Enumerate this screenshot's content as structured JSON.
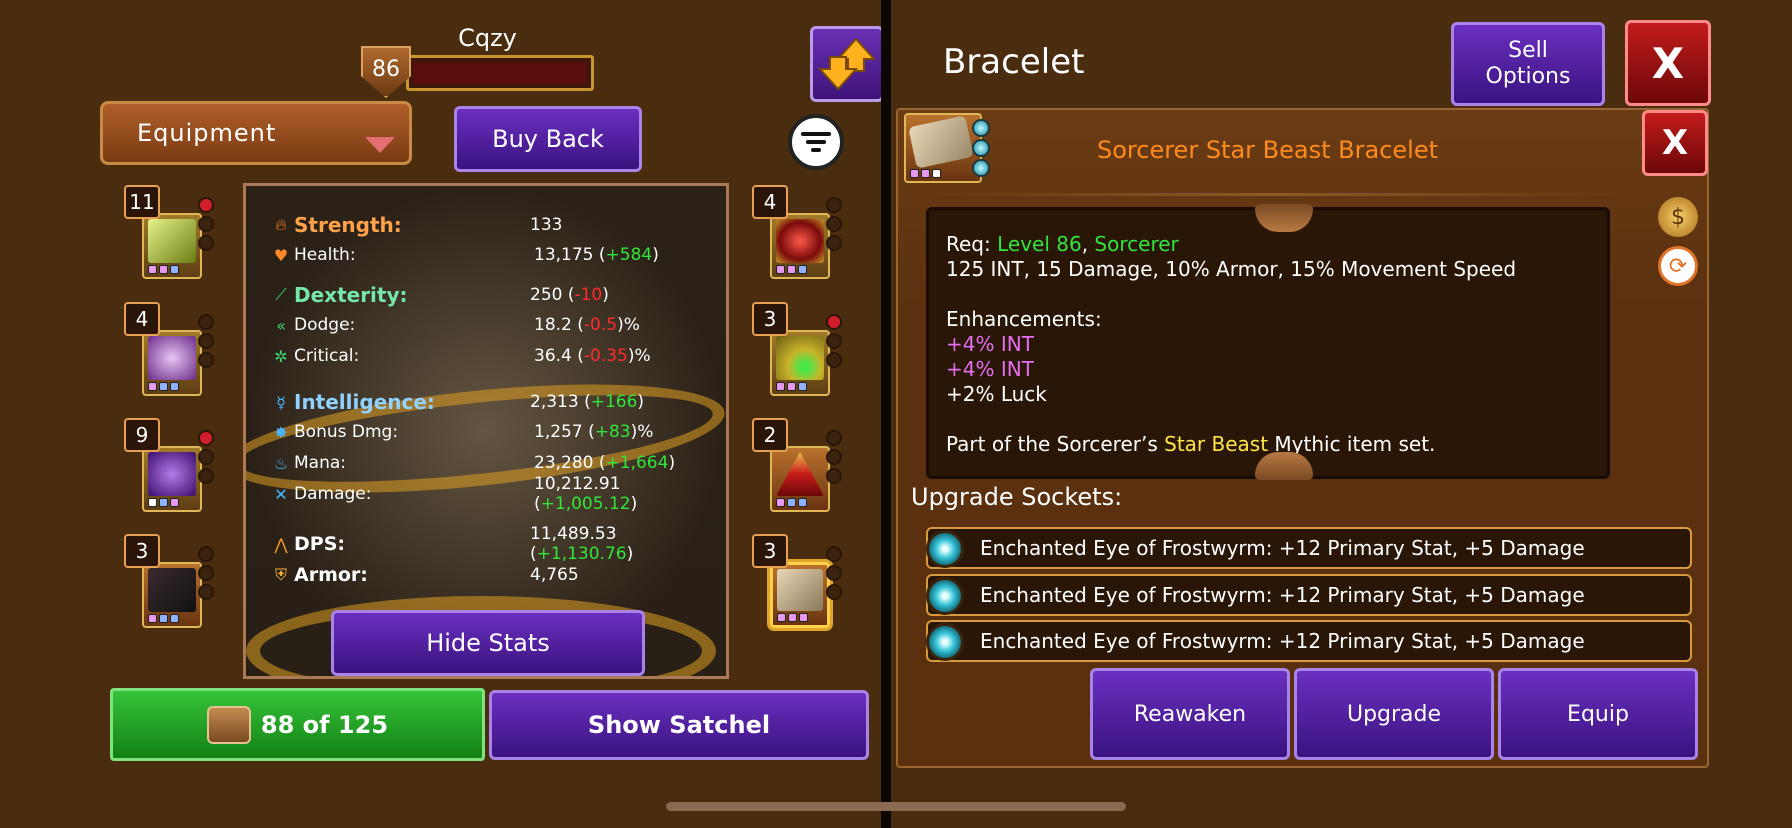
{
  "player": {
    "name": "Cqzy",
    "level": "86"
  },
  "left": {
    "dropdown_label": "Equipment",
    "buyback_label": "Buy Back",
    "hide_stats_label": "Hide Stats",
    "inventory_count": "88 of 125",
    "satchel_label": "Show Satchel"
  },
  "slots_left": [
    {
      "count": "11"
    },
    {
      "count": "4"
    },
    {
      "count": "9"
    },
    {
      "count": "3"
    }
  ],
  "slots_right": [
    {
      "count": "4"
    },
    {
      "count": "3"
    },
    {
      "count": "2"
    },
    {
      "count": "3"
    }
  ],
  "stats": {
    "strength": {
      "label": "Strength:",
      "value": "133"
    },
    "health": {
      "label": "Health:",
      "value": "13,175 (",
      "delta": "+584",
      "suffix": ")"
    },
    "dexterity": {
      "label": "Dexterity:",
      "value": "250 (",
      "delta": "-10",
      "suffix": ")"
    },
    "dodge": {
      "label": "Dodge:",
      "value": "18.2 (",
      "delta": "-0.5",
      "suffix": ")%"
    },
    "critical": {
      "label": "Critical:",
      "value": "36.4 (",
      "delta": "-0.35",
      "suffix": ")%"
    },
    "intelligence": {
      "label": "Intelligence:",
      "value": "2,313 (",
      "delta": "+166",
      "suffix": ")"
    },
    "bonus_dmg": {
      "label": "Bonus Dmg:",
      "value": "1,257 (",
      "delta": "+83",
      "suffix": ")%"
    },
    "mana": {
      "label": "Mana:",
      "value": "23,280 (",
      "delta": "+1,664",
      "suffix": ")"
    },
    "damage": {
      "label": "Damage:",
      "value": "10,212.91 (",
      "delta": "+1,005.12",
      "suffix": ")"
    },
    "dps": {
      "label": "DPS:",
      "value": "11,489.53 (",
      "delta": "+1,130.76",
      "suffix": ")"
    },
    "armor": {
      "label": "Armor:",
      "value": "4,765"
    }
  },
  "right": {
    "title": "Bracelet",
    "sell_label_1": "Sell",
    "sell_label_2": "Options",
    "close_symbol": "X",
    "item_name": "Sorcerer Star Beast Bracelet",
    "req_prefix": "Req: ",
    "req_level": "Level 86",
    "req_sep": ", ",
    "req_class": "Sorcerer",
    "base_stats": "125 INT, 15 Damage, 10% Armor, 15% Movement Speed",
    "enh_title": "Enhancements:",
    "enh_1": "+4% INT",
    "enh_2": "+4% INT",
    "enh_3": "+2% Luck",
    "set_prefix": "Part of the Sorcerer’s ",
    "set_name": "Star Beast",
    "set_suffix": " Mythic item set.",
    "sockets_title": "Upgrade Sockets:",
    "sockets": [
      "Enchanted Eye of Frostwyrm: +12 Primary Stat, +5 Damage",
      "Enchanted Eye of Frostwyrm: +12 Primary Stat, +5 Damage",
      "Enchanted Eye of Frostwyrm: +12 Primary Stat, +5 Damage"
    ],
    "reawaken_label": "Reawaken",
    "upgrade_label": "Upgrade",
    "equip_label": "Equip"
  },
  "colors": {
    "background": "#4a2c0f",
    "positive": "#31e53a",
    "negative": "#ff2b2b",
    "item_name": "#ff8a1e",
    "enhancement": "#e36ef0",
    "set_name": "#ffe64a"
  },
  "icons": [
    "swap-arrows-icon",
    "filter-icon",
    "chest-icon",
    "gold-bag-icon",
    "cycle-icon",
    "frost-eye-gem-icon"
  ]
}
